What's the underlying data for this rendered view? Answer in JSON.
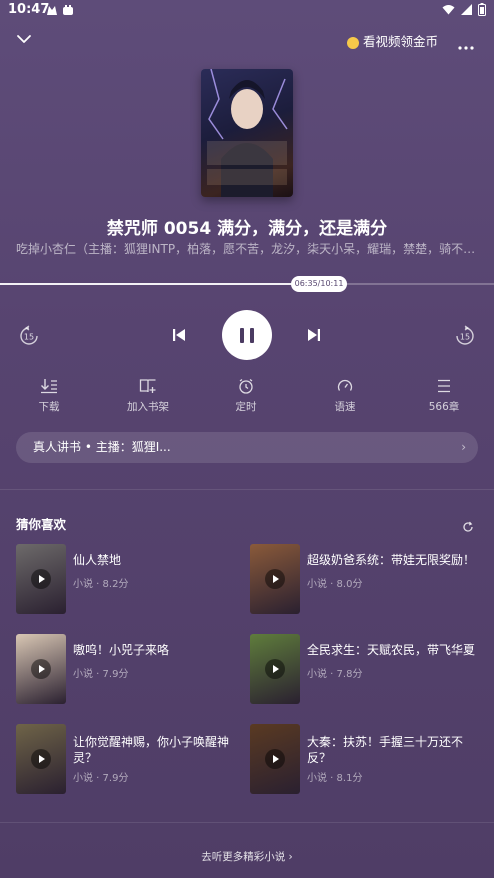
{
  "status_bar": {
    "time": "10:47"
  },
  "header": {
    "promo_text": "看视频领金币"
  },
  "track": {
    "title": "禁咒师 0054 满分，满分，还是满分",
    "subtitle": "吃掉小杏仁（主播：狐狸INTP，柏落，愿不苦，龙汐，柒天小呆，耀瑞，禁楚，骑不快的…",
    "position_label": "06:35/10:11",
    "progress_fraction": 0.646
  },
  "controls": {
    "rewind_label": "15",
    "forward_label": "15"
  },
  "features": [
    {
      "label": "下载"
    },
    {
      "label": "加入书架"
    },
    {
      "label": "定时"
    },
    {
      "label": "语速"
    },
    {
      "label": "566章"
    }
  ],
  "narrator_pill": {
    "text": "真人讲书 • 主播：狐狸I..."
  },
  "recommendations": {
    "title": "猜你喜欢",
    "items": [
      {
        "title": "仙人禁地",
        "meta": "小说 · 8.2分",
        "color": "#6d6a6a"
      },
      {
        "title": "超级奶爸系统：带娃无限奖励！",
        "meta": "小说 · 8.0分",
        "color": "#8a5a3a"
      },
      {
        "title": "嗷呜！小兕子来咯",
        "meta": "小说 · 7.9分",
        "color": "#d9c7b4"
      },
      {
        "title": "全民求生：天赋农民，带飞华夏",
        "meta": "小说 · 7.8分",
        "color": "#5f7d3c"
      },
      {
        "title": "让你觉醒神赐，你小子唤醒神灵？",
        "meta": "小说 · 7.9分",
        "color": "#6f6448"
      },
      {
        "title": "大秦：扶苏！手握三十万还不反？",
        "meta": "小说 · 8.1分",
        "color": "#5a3a22"
      }
    ]
  },
  "footer": {
    "more_label": "去听更多精彩小说 ›"
  }
}
